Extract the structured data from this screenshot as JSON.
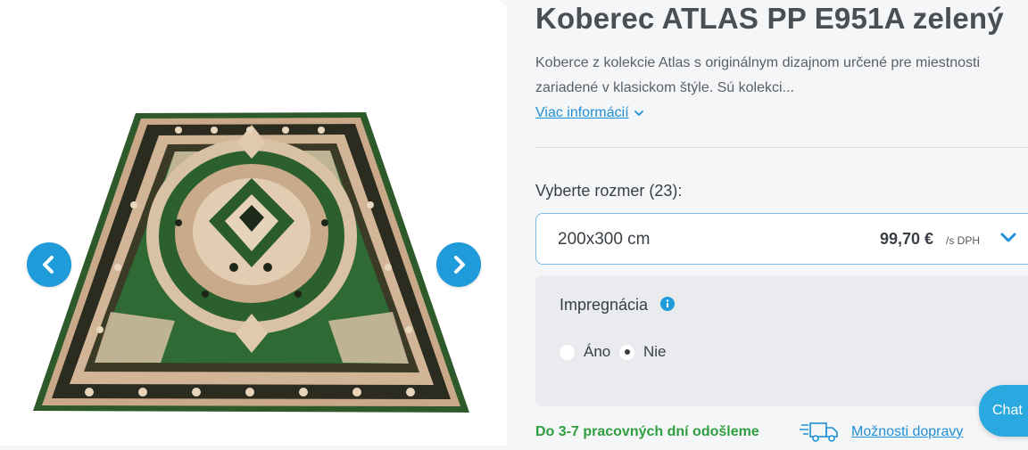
{
  "product": {
    "title": "Koberec ATLAS PP E951A zelený",
    "description": "Koberce z kolekcie Atlas s originálnym dizajnom určené pre miestnosti zariadené v klasickom štýle. Sú kolekci...",
    "more_info_label": "Viac informácií"
  },
  "gallery": {
    "image": "green-oriental-rug-photo",
    "prev_icon": "chevron-left-icon",
    "next_icon": "chevron-right-icon"
  },
  "size": {
    "label": "Vyberte rozmer (23):",
    "selected_value": "200x300 cm",
    "price": "99,70 €",
    "price_unit": "/s DPH"
  },
  "impregnation": {
    "title": "Impregnácia",
    "options": [
      {
        "label": "Áno",
        "selected": false
      },
      {
        "label": "Nie",
        "selected": true
      }
    ]
  },
  "shipping": {
    "time_text": "Do 3-7 pracovných dní odošleme",
    "options_link": "Možnosti dopravy",
    "icon": "delivery-truck-icon"
  },
  "chat": {
    "label": "Chat"
  },
  "colors": {
    "accent": "#1f9bd9",
    "link": "#1f8fd6",
    "success": "#2e9e3f",
    "rug_green": "#2f5b2c"
  }
}
